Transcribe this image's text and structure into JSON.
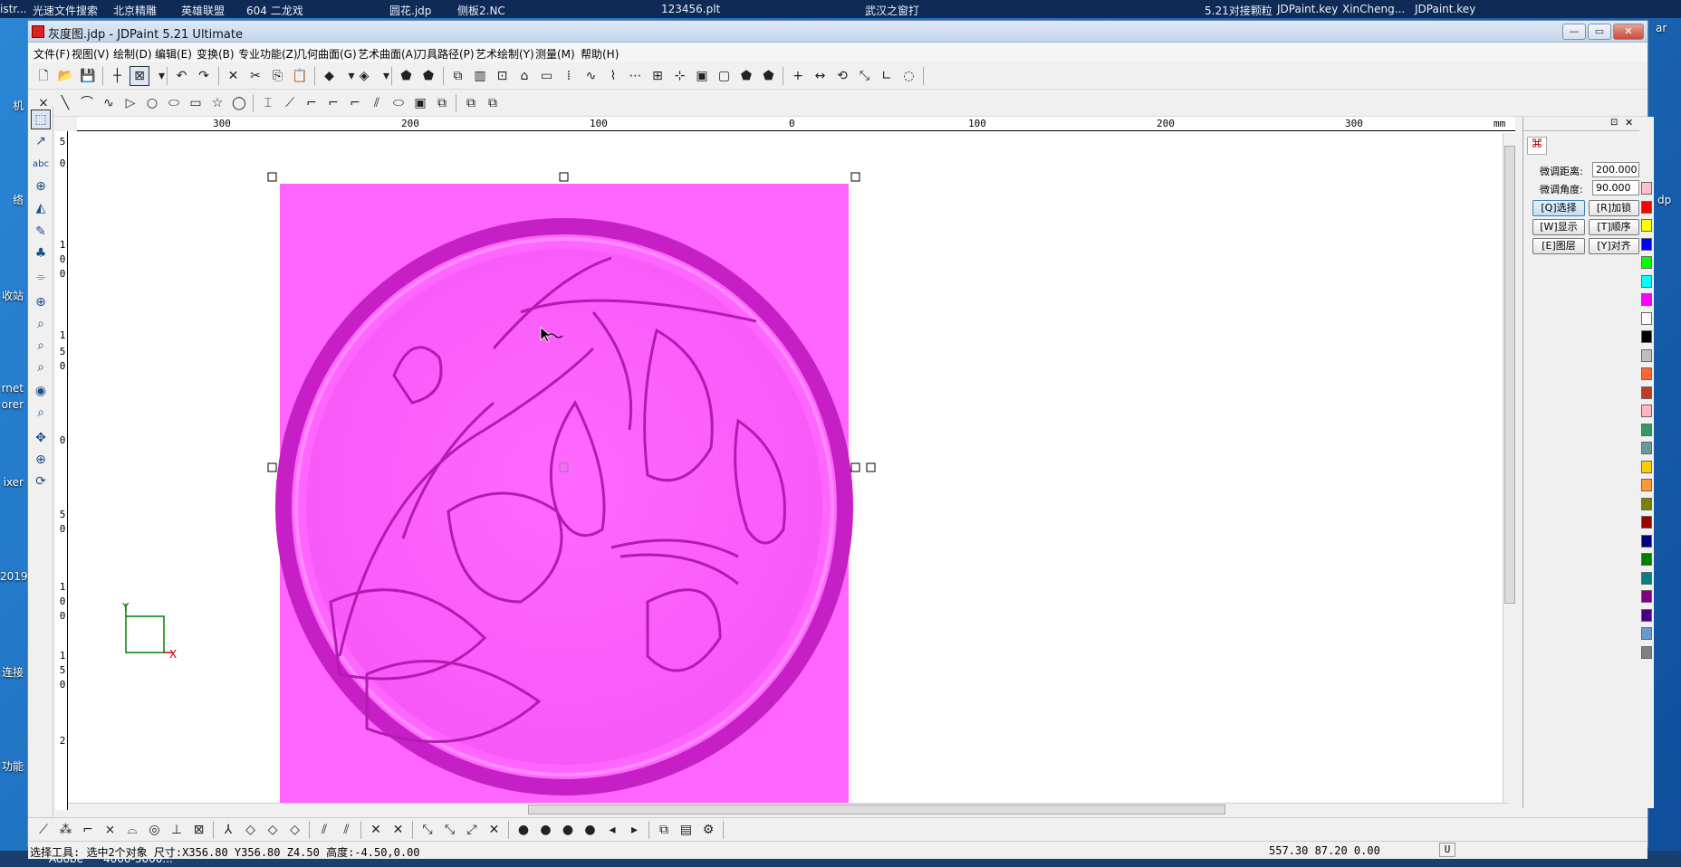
{
  "desktop": {
    "top_taskbar": [
      "istr...",
      "光速文件搜索",
      "北京精雕",
      "英雄联盟",
      "604 二龙戏",
      "圆花.jdp",
      "侧板2.NC",
      "123456.plt",
      "武汉之窗打",
      "5.21对接颗粒",
      "JDPaint.key",
      "XinCheng...",
      "JDPaint.key"
    ],
    "left_labels": [
      "机",
      "络",
      "收站",
      "rnet",
      "orer",
      "ixer",
      "2019",
      "连接",
      "功能"
    ],
    "right_labels": [
      "ar",
      "dp"
    ],
    "bottom_taskbar": [
      "Adobe",
      "4000-3000..."
    ]
  },
  "window": {
    "title": "灰度图.jdp - JDPaint 5.21 Ultimate",
    "controls": [
      "—",
      "▭",
      "✕"
    ]
  },
  "menu": [
    "文件(F)",
    "视图(V)",
    "绘制(D)",
    "编辑(E)",
    "变换(B)",
    "专业功能(Z)",
    "几何曲面(G)",
    "艺术曲面(A)",
    "刀具路径(P)",
    "艺术绘制(Y)",
    "测量(M)",
    "帮助(H)"
  ],
  "toolbar1": {
    "icons": [
      "new-icon",
      "open-icon",
      "save-icon",
      "crosshair-icon",
      "select-window-icon",
      "dropdown-icon",
      "undo-icon",
      "redo-icon",
      "delete-icon",
      "cut-icon",
      "copy-icon",
      "paste-icon",
      "shade-icon",
      "dropdown-icon",
      "view3d-icon",
      "dropdown-icon",
      "shield-icon",
      "shield-dark-icon",
      "group-icon",
      "align-icon",
      "node-icon",
      "break-icon",
      "trim-icon",
      "array-icon",
      "curve-edit-icon",
      "spline-icon",
      "path-icon",
      "grid-icon",
      "snap-icon",
      "layer-icon",
      "layer2-icon",
      "shield2-icon",
      "shield3-icon",
      "plus-icon",
      "measure-icon",
      "rotate-icon",
      "scale-icon",
      "angle-icon",
      "lasso-icon"
    ],
    "glyphs": [
      "🗋",
      "📂",
      "💾",
      "┼",
      "⊠",
      "▾",
      "↶",
      "↷",
      "✕",
      "✂",
      "⎘",
      "📋",
      "◆",
      "▾",
      "◈",
      "▾",
      "⬟",
      "⬟",
      "⧉",
      "▥",
      "⊡",
      "⌂",
      "▭",
      "⁞",
      "∿",
      "⌇",
      "⋯",
      "⊞",
      "⊹",
      "▣",
      "▢",
      "⬟",
      "⬟",
      "+",
      "↔",
      "⟲",
      "⤡",
      "∟",
      "◌"
    ]
  },
  "toolbar2": {
    "icons": [
      "point-icon",
      "line-icon",
      "arc-icon",
      "spline-icon",
      "polyline-icon",
      "circle-icon",
      "ellipse-icon",
      "rectangle-icon",
      "star-icon",
      "circle2-icon",
      "trim-icon",
      "extend-icon",
      "fillet-icon",
      "chamfer-icon",
      "corner-icon",
      "offset-icon",
      "slot-icon",
      "frame-icon",
      "transform1-icon",
      "transform2-icon",
      "transform3-icon"
    ],
    "glyphs": [
      "×",
      "╲",
      "⌒",
      "∿",
      "▷",
      "○",
      "⬭",
      "▭",
      "☆",
      "◯",
      "⌶",
      "⟋",
      "⌐",
      "⌐",
      "⌐",
      "⫽",
      "⬭",
      "▣",
      "⧉",
      "⧉",
      "⧉"
    ]
  },
  "left_tools": {
    "icons": [
      "select-icon",
      "node-edit-icon",
      "text-icon",
      "transform-icon",
      "paint-icon",
      "pen-icon",
      "color-icon",
      "measure-icon",
      "zoom-window-icon",
      "zoom-in-icon",
      "zoom-out-icon",
      "zoom-fit-icon",
      "eye-icon",
      "zoom-all-icon",
      "pan-icon",
      "zoom-icon",
      "rotate-view-icon"
    ],
    "glyphs": [
      "⬚",
      "↗",
      "abc",
      "⊕",
      "◭",
      "✎",
      "♣",
      "⌯",
      "⊕",
      "⌕",
      "⌕",
      "⌕",
      "◉",
      "⌕",
      "✥",
      "⊕",
      "⟳"
    ]
  },
  "rulers": {
    "top": [
      "300",
      "200",
      "100",
      "0",
      "100",
      "200",
      "300",
      "mm"
    ],
    "left": [
      "5",
      "0",
      "1",
      "0",
      "0",
      "1",
      "5",
      "0",
      "0",
      "5",
      "0",
      "1",
      "0",
      "0",
      "1",
      "5",
      "0",
      "2"
    ]
  },
  "panel": {
    "labels": {
      "distance": "微调距离:",
      "angle": "微调角度:"
    },
    "values": {
      "distance": "200.000",
      "angle": "90.000"
    },
    "buttons": [
      "[Q]选择",
      "[R]加锁",
      "[W]显示",
      "[T]顺序",
      "[E]图层",
      "[Y]对齐"
    ],
    "header_icons": [
      "pin-icon",
      "close-icon"
    ]
  },
  "palette": {
    "colors": [
      "#ffc0cb",
      "#ff0000",
      "#ffff00",
      "#0000ff",
      "#00ff00",
      "#00ffff",
      "#ff00ff",
      "#ffffff",
      "#000000",
      "#bfbfbf",
      "#ff6633",
      "#c0392b",
      "#ffb6c1",
      "#339966",
      "#669999",
      "#ffcc00",
      "#ff9933",
      "#808000",
      "#990000",
      "#000080",
      "#008000",
      "#008080",
      "#800080",
      "#4b0082",
      "#6699cc",
      "#808080"
    ]
  },
  "bottom_tools": {
    "icons": [
      "snap-line-icon",
      "snap-point-icon",
      "snap-fillet-icon",
      "snap-cross-icon",
      "snap-arc-icon",
      "snap-center-icon",
      "snap-perp-icon",
      "snap-box-icon",
      "snap-angle-icon",
      "snap-diamond1-icon",
      "snap-diamond2-icon",
      "snap-diamond3-icon",
      "surface1-icon",
      "surface2-icon",
      "delete-node1-icon",
      "delete-node2-icon",
      "path1-icon",
      "path2-icon",
      "path3-icon",
      "cancel-icon",
      "light1-icon",
      "light2-icon",
      "light3-icon",
      "light4-icon",
      "light5-icon",
      "light6-icon",
      "copy-layer-icon",
      "hatch-icon",
      "settings-icon"
    ],
    "glyphs": [
      "⟋",
      "⁂",
      "⌐",
      "⨯",
      "⌓",
      "◎",
      "⊥",
      "⊠",
      "⅄",
      "◇",
      "◇",
      "◇",
      "⫽",
      "⫽",
      "✕",
      "✕",
      "⤡",
      "⤡",
      "⤢",
      "✕",
      "●",
      "●",
      "●",
      "●",
      "◂",
      "▸",
      "⧉",
      "▤",
      "⚙"
    ]
  },
  "status": {
    "left": "选择工具: 选中2个对象 尺寸:X356.80 Y356.80 Z4.50 高度:-4.50,0.00",
    "coords": "557.30 87.20 0.00",
    "mode": "U"
  },
  "axes": {
    "x": "X",
    "y": "Y"
  }
}
